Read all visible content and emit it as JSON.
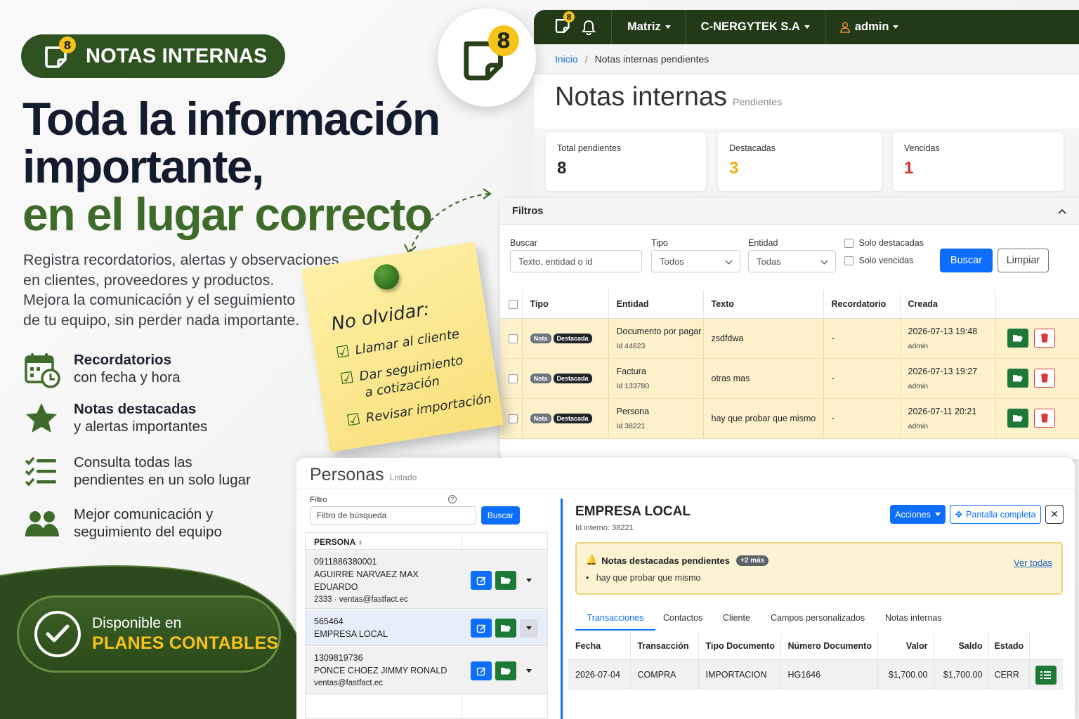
{
  "promo": {
    "pill_badge": "8",
    "pill_label": "NOTAS INTERNAS",
    "headline_1": "Toda la información",
    "headline_2": "importante,",
    "headline_3": "en el lugar correcto",
    "desc_1": "Registra recordatorios, alertas y observaciones",
    "desc_2": "en clientes, proveedores y productos.",
    "desc_3": "Mejora la comunicación y el seguimiento",
    "desc_4": "de tu equipo, sin perder nada importante.",
    "features": [
      {
        "title": "Recordatorios",
        "sub": "con fecha y hora",
        "icon": "calendar-clock-icon"
      },
      {
        "title": "Notas destacadas",
        "sub": "y alertas importantes",
        "icon": "star-icon"
      },
      {
        "title": "",
        "sub1": "Consulta todas las",
        "sub2": "pendientes en un solo lugar",
        "icon": "checklist-icon"
      },
      {
        "title": "",
        "sub1": "Mejor comunicación y",
        "sub2": "seguimiento del equipo",
        "icon": "users-icon"
      }
    ],
    "available_label": "Disponible en",
    "plans_label": "PLANES CONTABLES",
    "big_badge": "8",
    "colors": {
      "brand_green": "#2f5221",
      "accent_yellow": "#f6c31b",
      "headline_navy": "#131b2e",
      "headline_green": "#3f6b2a"
    }
  },
  "note": {
    "title": "No olvidar:",
    "items": [
      "Llamar al cliente",
      "Dar seguimiento",
      "a cotización",
      "Revisar importación"
    ]
  },
  "navbar": {
    "badge": "8",
    "branch": "Matriz",
    "company": "C-NERGYTEK S.A",
    "user": "admin"
  },
  "breadcrumb": {
    "home": "Inicio",
    "sep": "/",
    "current": "Notas internas pendientes"
  },
  "page": {
    "title": "Notas internas",
    "subtitle": "Pendientes"
  },
  "stats": [
    {
      "label": "Total pendientes",
      "value": "8",
      "color": "#212529"
    },
    {
      "label": "Destacadas",
      "value": "3",
      "color": "#f0ad0e"
    },
    {
      "label": "Vencidas",
      "value": "1",
      "color": "#d32f2f"
    }
  ],
  "filters": {
    "title": "Filtros",
    "search_label": "Buscar",
    "search_placeholder": "Texto, entidad o id",
    "type_label": "Tipo",
    "type_value": "Todos",
    "entity_label": "Entidad",
    "entity_value": "Todas",
    "only_starred": "Solo destacadas",
    "only_expired": "Solo vencidas",
    "search_btn": "Buscar",
    "clear_btn": "Limpiar"
  },
  "notes_table": {
    "headers": [
      "Tipo",
      "Entidad",
      "Texto",
      "Recordatorio",
      "Creada"
    ],
    "rows": [
      {
        "tag1": "Nota",
        "tag2": "Destacada",
        "entity": "Documento por pagar",
        "entity_id": "Id 44623",
        "text": "zsdfdwa",
        "reminder": "-",
        "created": "2026-07-13 19:48",
        "user": "admin"
      },
      {
        "tag1": "Nota",
        "tag2": "Destacada",
        "entity": "Factura",
        "entity_id": "Id 133780",
        "text": "otras mas",
        "reminder": "-",
        "created": "2026-07-13 19:27",
        "user": "admin"
      },
      {
        "tag1": "Nota",
        "tag2": "Destacada",
        "entity": "Persona",
        "entity_id": "Id 38221",
        "text": "hay que probar que mismo",
        "reminder": "-",
        "created": "2026-07-11 20:21",
        "user": "admin"
      }
    ]
  },
  "personas": {
    "title": "Personas",
    "subtitle": "Listado",
    "filter_label": "Filtro",
    "filter_placeholder": "Filtro de búsqueda",
    "search_btn": "Buscar",
    "col_header": "PERSONA",
    "rows": [
      {
        "line1": "0911886380001",
        "line2": "AGUIRRE NARVAEZ MAX",
        "line3": "EDUARDO",
        "line4": "2333 · ventas@fastfact.ec"
      },
      {
        "line1": "565464",
        "line2": "EMPRESA LOCAL",
        "line3": "",
        "line4": ""
      },
      {
        "line1": "1309819736",
        "line2": "PONCE CHOEZ JIMMY RONALD",
        "line3": "ventas@fastfact.ec",
        "line4": ""
      }
    ]
  },
  "detail": {
    "name": "EMPRESA LOCAL",
    "internal_id": "Id interno: 38221",
    "actions_btn": "Acciones",
    "fullscreen_btn": "Pantalla completa",
    "close_btn": "✕",
    "alert_title": "Notas destacadas pendientes",
    "alert_more": "+2 más",
    "alert_item": "hay que probar que mismo",
    "alert_link": "Ver todas",
    "tabs": [
      "Transacciones",
      "Contactos",
      "Cliente",
      "Campos personalizados",
      "Notas internas"
    ],
    "table_headers": [
      "Fecha",
      "Transacción",
      "Tipo Documento",
      "Número Documento",
      "Valor",
      "Saldo",
      "Estado"
    ],
    "table_row": [
      "2026-07-04",
      "COMPRA",
      "IMPORTACION",
      "HG1646",
      "$1,700.00",
      "$1,700.00",
      "CERR"
    ]
  }
}
